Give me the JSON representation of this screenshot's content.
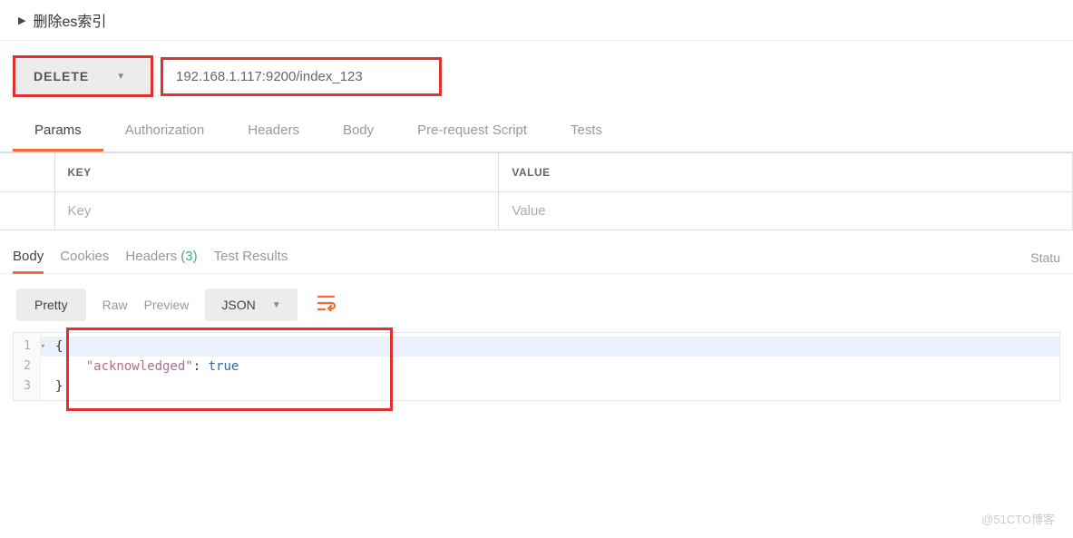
{
  "header": {
    "title": "删除es索引"
  },
  "request": {
    "method": "DELETE",
    "url": "192.168.1.117:9200/index_123"
  },
  "tabs_request": [
    "Params",
    "Authorization",
    "Headers",
    "Body",
    "Pre-request Script",
    "Tests"
  ],
  "tabs_request_active": 0,
  "kv": {
    "key_header": "KEY",
    "value_header": "VALUE",
    "key_placeholder": "Key",
    "value_placeholder": "Value"
  },
  "tabs_response": {
    "body": "Body",
    "cookies": "Cookies",
    "headers": "Headers",
    "headers_count": "(3)",
    "test_results": "Test Results",
    "status_label": "Statu"
  },
  "toolbar": {
    "pretty": "Pretty",
    "raw": "Raw",
    "preview": "Preview",
    "format": "JSON"
  },
  "code": {
    "lines": [
      "1",
      "2",
      "3"
    ],
    "l1": "{",
    "l2_key": "\"acknowledged\"",
    "l2_sep": ": ",
    "l2_val": "true",
    "l3": "}"
  },
  "watermark": "@51CTO博客"
}
